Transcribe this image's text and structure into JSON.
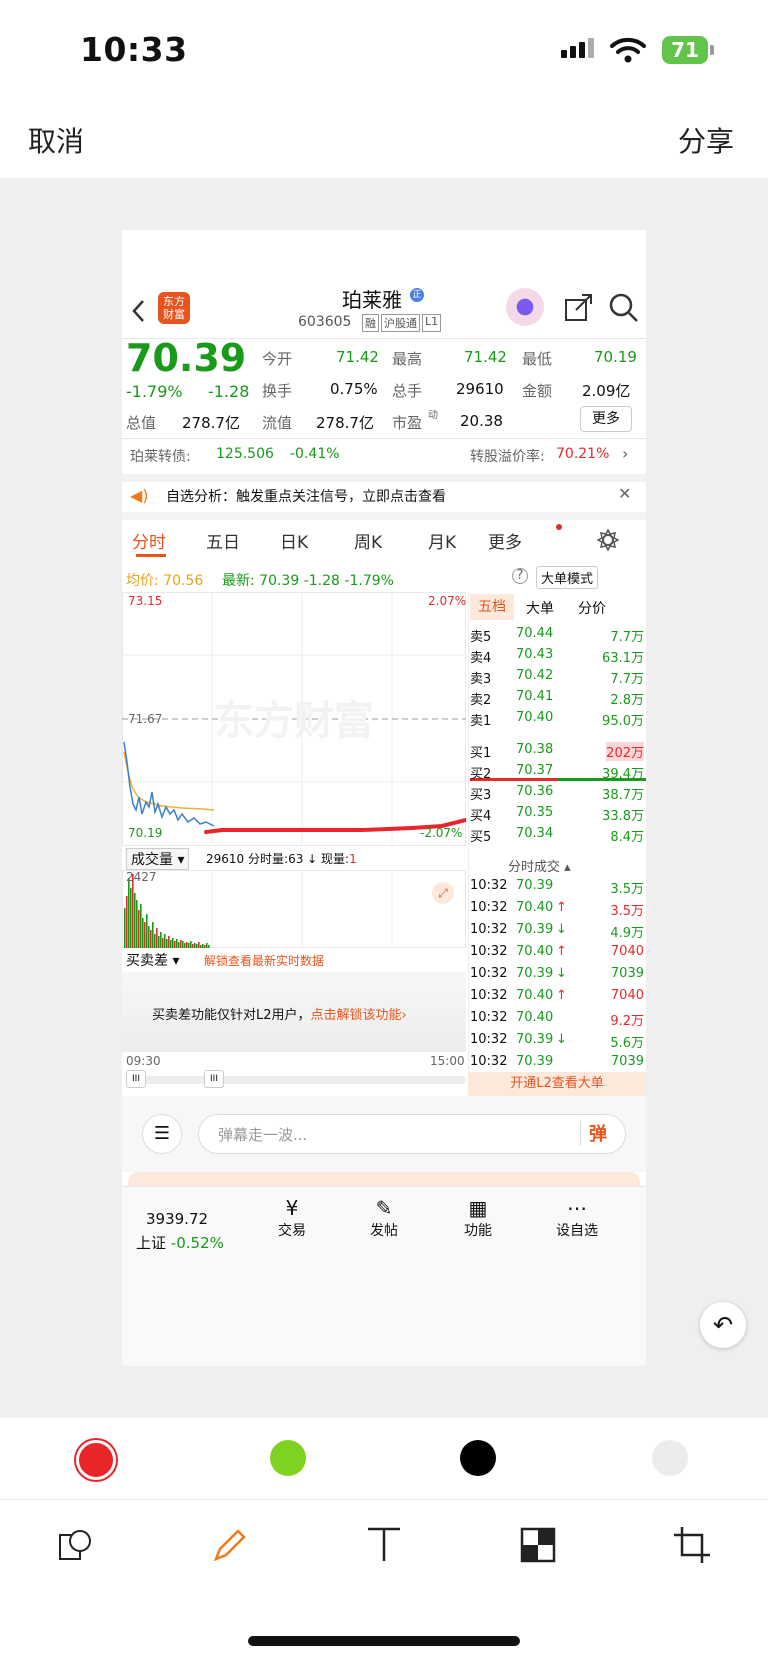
{
  "status": {
    "time": "10:33",
    "battery": "71"
  },
  "editor": {
    "cancel": "取消",
    "share": "分享"
  },
  "app": {
    "logo": "东方\n财富",
    "stock_name": "珀莱雅",
    "code": "603605",
    "tags": [
      "融",
      "沪股通",
      "L1"
    ],
    "price": "70.39",
    "change_pct": "-1.79%",
    "change": "-1.28",
    "stats": {
      "open_label": "今开",
      "open": "71.42",
      "high_label": "最高",
      "high": "71.42",
      "low_label": "最低",
      "low": "70.19",
      "turnover_label": "换手",
      "turnover": "0.75%",
      "volume_label": "总手",
      "volume": "29610",
      "amount_label": "金额",
      "amount": "2.09亿",
      "mktcap_label": "总值",
      "mktcap": "278.7亿",
      "float_label": "流值",
      "float": "278.7亿",
      "pe_label": "市盈",
      "pe_sup": "动",
      "pe": "20.38",
      "more": "更多"
    },
    "bond": {
      "label": "珀莱转债:",
      "price": "125.506",
      "pct": "-0.41%",
      "premium_label": "转股溢价率:",
      "premium": "70.21%"
    },
    "notice": "自选分析：触发重点关注信号，立即点击查看",
    "tabs": [
      "分时",
      "五日",
      "日K",
      "周K",
      "月K",
      "更多"
    ],
    "avg_line": {
      "avg_label": "均价:",
      "avg": "70.56",
      "latest_label": "最新:",
      "latest": "70.39",
      "chg": "-1.28",
      "pct": "-1.79%",
      "big_order": "大单模式"
    },
    "chart": {
      "high": "73.15",
      "high_pct": "2.07%",
      "mid": "71.67",
      "low": "70.19",
      "low_pct": "-2.07%",
      "watermark": "东方财富",
      "start_time": "09:30",
      "end_time": "15:00"
    },
    "vol_bar": {
      "selector": "成交量",
      "total": "29610",
      "min_label": "分时量:",
      "min_vol": "63",
      "now_label": "现量:",
      "now": "1",
      "max": "2427"
    },
    "diff": {
      "selector": "买卖差",
      "unlock": "解锁查看最新实时数据",
      "msg": "买卖差功能仅针对L2用户，",
      "link": "点击解锁该功能"
    },
    "book_tabs": [
      "五档",
      "大单",
      "分价"
    ],
    "asks": [
      {
        "label": "卖5",
        "price": "70.44",
        "vol": "7.7万"
      },
      {
        "label": "卖4",
        "price": "70.43",
        "vol": "63.1万"
      },
      {
        "label": "卖3",
        "price": "70.42",
        "vol": "7.7万"
      },
      {
        "label": "卖2",
        "price": "70.41",
        "vol": "2.8万"
      },
      {
        "label": "卖1",
        "price": "70.40",
        "vol": "95.0万"
      }
    ],
    "bids": [
      {
        "label": "买1",
        "price": "70.38",
        "vol": "202万"
      },
      {
        "label": "买2",
        "price": "70.37",
        "vol": "39.4万"
      },
      {
        "label": "买3",
        "price": "70.36",
        "vol": "38.7万"
      },
      {
        "label": "买4",
        "price": "70.35",
        "vol": "33.8万"
      },
      {
        "label": "买5",
        "price": "70.34",
        "vol": "8.4万"
      }
    ],
    "trades_title": "分时成交",
    "trades": [
      {
        "time": "10:32",
        "price": "70.39",
        "arrow": "",
        "vol": "3.5万"
      },
      {
        "time": "10:32",
        "price": "70.40",
        "arrow": "↑",
        "vol": "3.5万"
      },
      {
        "time": "10:32",
        "price": "70.39",
        "arrow": "↓",
        "vol": "4.9万"
      },
      {
        "time": "10:32",
        "price": "70.40",
        "arrow": "↑",
        "vol": "7040"
      },
      {
        "time": "10:32",
        "price": "70.39",
        "arrow": "↓",
        "vol": "7039"
      },
      {
        "time": "10:32",
        "price": "70.40",
        "arrow": "↑",
        "vol": "7040"
      },
      {
        "time": "10:32",
        "price": "70.40",
        "arrow": "",
        "vol": "9.2万"
      },
      {
        "time": "10:32",
        "price": "70.39",
        "arrow": "↓",
        "vol": "5.6万"
      },
      {
        "time": "10:32",
        "price": "70.39",
        "arrow": "",
        "vol": "7039"
      }
    ],
    "l2_banner": "开通L2查看大单",
    "danmu_placeholder": "弹幕走一波...",
    "danmu_btn": "弹",
    "index_value": "3939.72",
    "index_name": "上证",
    "index_pct": "-0.52%",
    "bottom_nav": [
      "交易",
      "发帖",
      "功能",
      "设自选"
    ]
  },
  "colors": {
    "red": "#e8262a",
    "green": "#7ed321",
    "black": "#000000",
    "light": "#ececec",
    "accent": "#f07a1a"
  }
}
